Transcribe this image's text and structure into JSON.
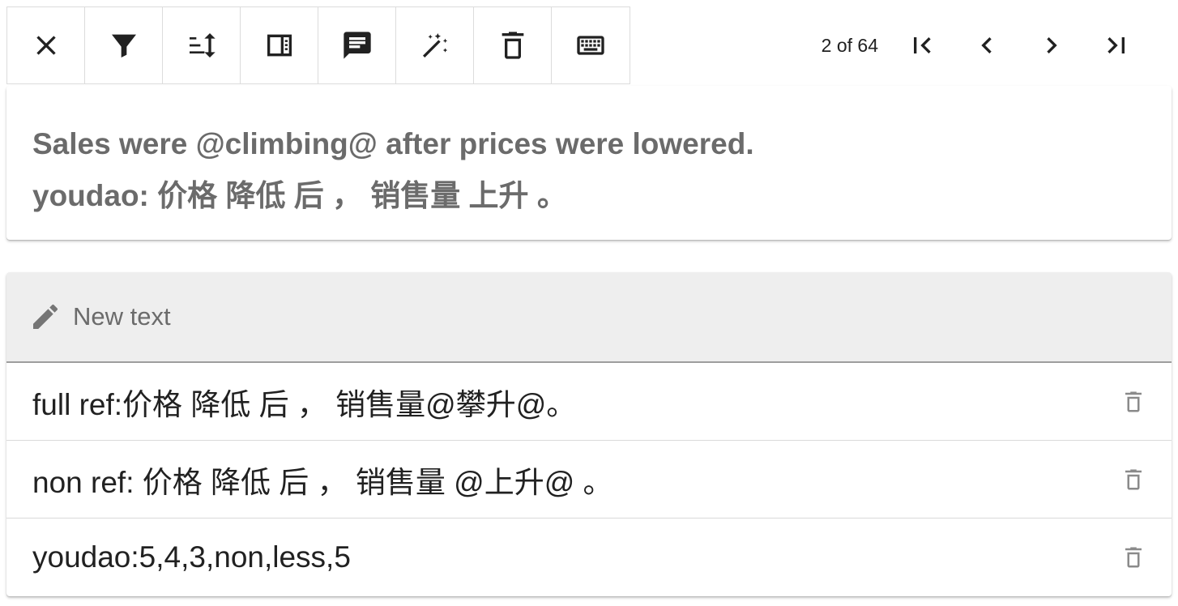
{
  "toolbar": {
    "buttons": [
      {
        "icon": "close-icon"
      },
      {
        "icon": "filter-icon"
      },
      {
        "icon": "sort-icon"
      },
      {
        "icon": "reader-panel-icon"
      },
      {
        "icon": "comment-icon"
      },
      {
        "icon": "magic-wand-icon"
      },
      {
        "icon": "delete-icon"
      },
      {
        "icon": "keyboard-icon"
      }
    ]
  },
  "pager": {
    "text": "2 of 64"
  },
  "source": {
    "sentence": "Sales were @climbing@ after prices were lowered.",
    "hint": "youdao: 价格 降低 后 ， 销售量 上升 。"
  },
  "translations": {
    "placeholder": "New text",
    "items": [
      {
        "text": "full ref:价格 降低 后 ， 销售量@攀升@。"
      },
      {
        "text": "non ref: 价格 降低 后 ， 销售量 @上升@ 。"
      },
      {
        "text": "youdao:5,4,3,non,less,5"
      }
    ]
  }
}
